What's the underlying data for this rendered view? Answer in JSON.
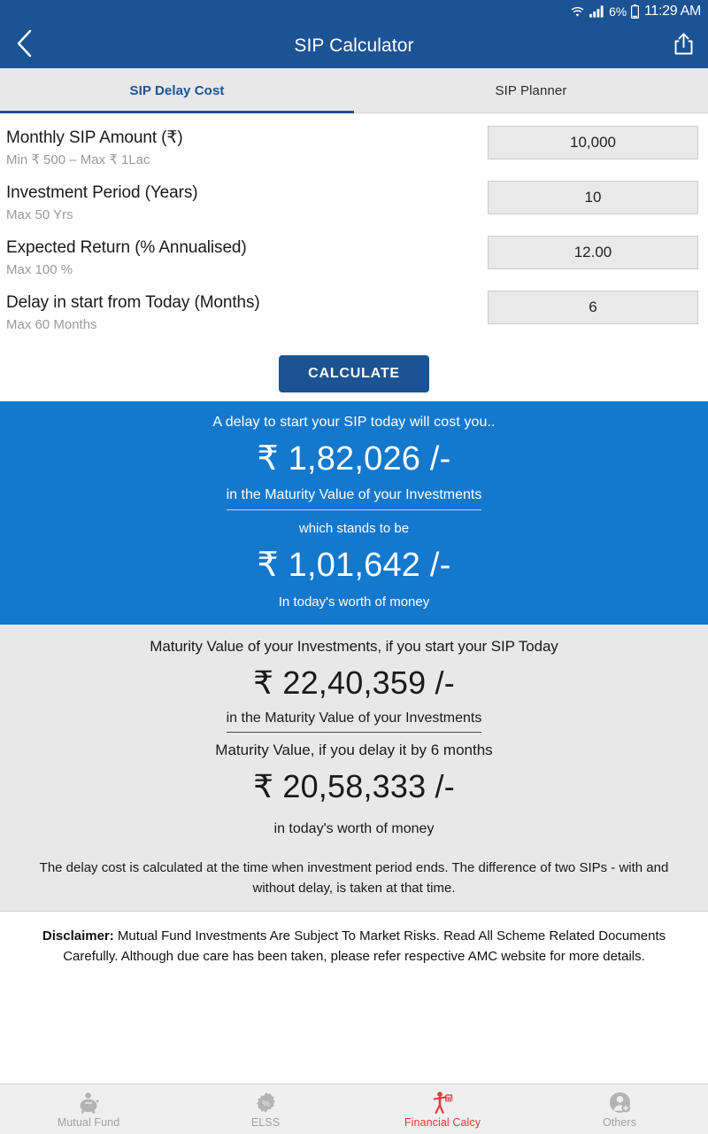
{
  "statusbar": {
    "wifi_icon": "wifi-icon",
    "signal_icon": "cellular-signal-icon",
    "battery_percent": "6%",
    "battery_icon": "battery-icon",
    "time": "11:29 AM"
  },
  "appbar": {
    "back_icon": "back-chevron-icon",
    "title": "SIP Calculator",
    "share_icon": "share-icon",
    "background_color": "#1b5394"
  },
  "tabs": [
    {
      "label": "SIP Delay Cost",
      "active": true
    },
    {
      "label": "SIP Planner",
      "active": false
    }
  ],
  "form": {
    "fields": [
      {
        "label": "Monthly SIP Amount (₹)",
        "hint": "Min ₹ 500 – Max ₹ 1Lac",
        "value": "10,000"
      },
      {
        "label": "Investment Period (Years)",
        "hint": "Max 50 Yrs",
        "value": "10"
      },
      {
        "label": "Expected Return (% Annualised)",
        "hint": "Max 100 %",
        "value": "12.00"
      },
      {
        "label": "Delay in start from Today (Months)",
        "hint": "Max 60 Months",
        "value": "6"
      }
    ],
    "calculate_label": "CALCULATE"
  },
  "blue_panel": {
    "background_color": "#1478cd",
    "caption": "A delay to start your SIP today will cost you..",
    "amount": "₹ 1,82,026 /-",
    "sub": "in the Maturity Value of your Investments",
    "mid": "which stands to be",
    "amount2": "₹ 1,01,642 /-",
    "foot": "In today's worth of money"
  },
  "gray_panel": {
    "background_color": "#e8e8e8",
    "caption": "Maturity Value of your Investments, if you start your SIP Today",
    "amount": "₹ 22,40,359 /-",
    "sub": "in the Maturity Value of your Investments",
    "caption2": "Maturity Value, if you delay it by 6 months",
    "amount2": "₹ 20,58,333 /-",
    "foot": "in today's worth of money",
    "note": "The delay cost is calculated at the time when investment period ends. The difference of two SIPs - with and without delay, is taken at that time."
  },
  "disclaimer": {
    "label": "Disclaimer:",
    "text": " Mutual Fund Investments Are Subject To Market Risks. Read All Scheme Related Documents Carefully. Although due care has been taken, please refer respective AMC website for more details."
  },
  "bottomnav": {
    "active_color": "#e23b3b",
    "items": [
      {
        "label": "Mutual Fund",
        "icon": "piggy-bank-icon",
        "active": false
      },
      {
        "label": "ELSS",
        "icon": "percent-badge-icon",
        "active": false
      },
      {
        "label": "Financial Calcy",
        "icon": "person-calculator-icon",
        "active": true
      },
      {
        "label": "Others",
        "icon": "add-user-icon",
        "active": false
      }
    ]
  }
}
